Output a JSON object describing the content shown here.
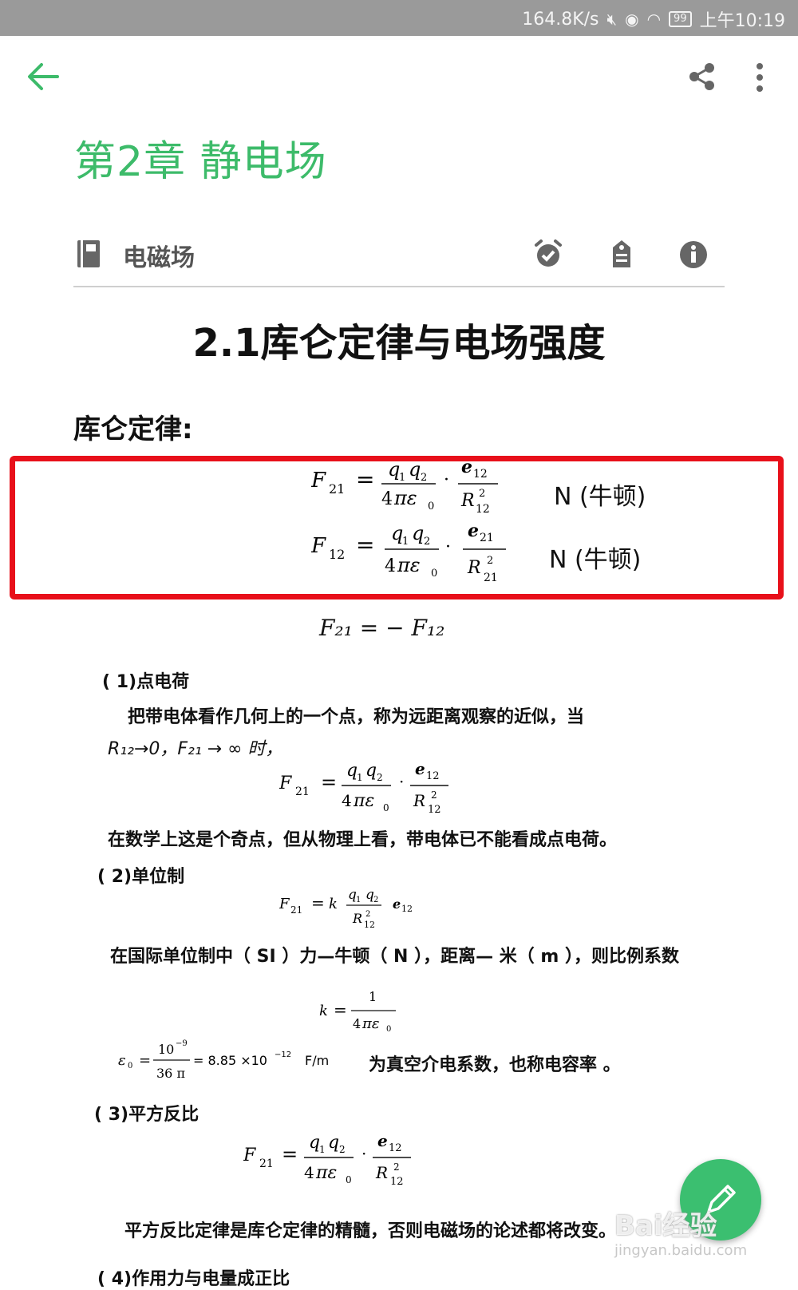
{
  "status_bar": {
    "speed": "164.8K/s",
    "battery": "99",
    "time": "上午10:19",
    "icons": [
      "mute-icon",
      "eye-icon",
      "wifi-icon",
      "battery-icon"
    ]
  },
  "app_bar": {
    "accent_color": "#3dbb6a",
    "icons": [
      "back-arrow-icon",
      "share-icon",
      "more-vert-icon"
    ]
  },
  "chapter_title": "第2章 静电场",
  "notebook": {
    "label": "电磁场",
    "icons": [
      "notebook-icon",
      "alarm-icon",
      "tag-icon",
      "info-icon"
    ]
  },
  "document": {
    "title": "2.1库仑定律与电场强度",
    "section_heading": "库仑定律:",
    "formula_unit": "N (牛顿)",
    "formula_newton3": "F₂₁ = − F₁₂",
    "point_charge": {
      "heading": "( 1)点电荷",
      "line1": "把带电体看作几何上的一个点，称为远距离观察的近似，当",
      "line2": "R₁₂→0，F₂₁ → ∞ 时，",
      "conclusion": "在数学上这是个奇点，但从物理上看，带电体已不能看成点电荷。"
    },
    "units": {
      "heading": "( 2)单位制",
      "text": "在国际单位制中（ SI ）力—牛顿（ N ），距离— 米（ m ），则比例系数",
      "epsilon_value": "= 8.85 ×10",
      "epsilon_exp": "−12",
      "epsilon_unit": "F/m",
      "epsilon_desc": "为真空介电系数，也称电容率 。",
      "eps_num": "10",
      "eps_num_exp": "−9",
      "eps_den": "36 π",
      "k_num": "1"
    },
    "inverse_square": {
      "heading": "( 3)平方反比",
      "text": "平方反比定律是库仑定律的精髓，否则电磁场的论述都将改变。"
    },
    "next_heading": "( 4)作用力与电量成正比"
  },
  "watermark": {
    "brand": "Bai经验",
    "url": "jingyan.baidu.com"
  },
  "fab": {
    "icon": "edit-pen-icon"
  }
}
